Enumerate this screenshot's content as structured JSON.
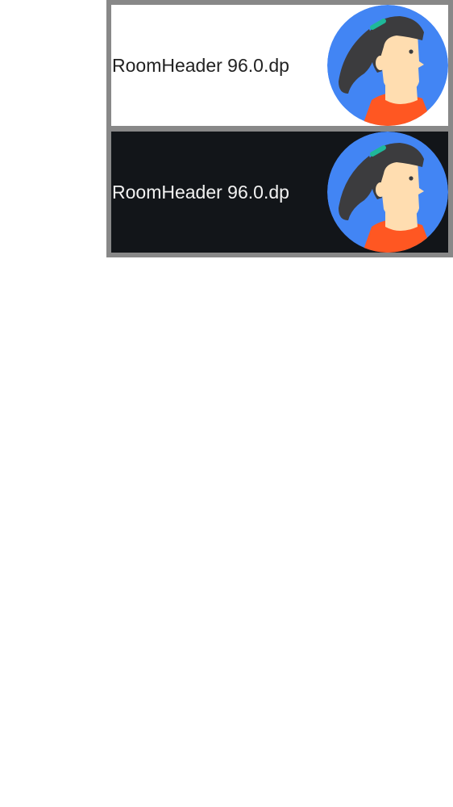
{
  "rooms": [
    {
      "label": "RoomHeader 96.0.dp",
      "theme": "light",
      "background": "#ffffff",
      "avatar_icon": "woman-avatar-icon"
    },
    {
      "label": "RoomHeader 96.0.dp",
      "theme": "dark",
      "background": "#121519",
      "avatar_icon": "woman-avatar-icon"
    }
  ],
  "colors": {
    "frame": "#888888",
    "avatar_circle": "#4285f4",
    "hair": "#3c3c3e",
    "skin": "#ffddb0",
    "shirt": "#ff5722",
    "hair_clip": "#1fb89a"
  }
}
